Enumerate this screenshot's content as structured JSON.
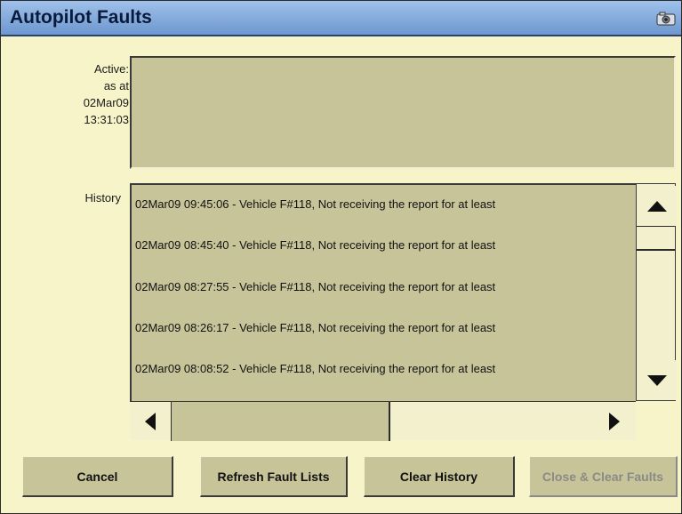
{
  "window": {
    "title": "Autopilot Faults",
    "title_icon": "camera-icon"
  },
  "active": {
    "label_lines": [
      "Active:",
      "as at",
      "02Mar09",
      "13:31:03"
    ],
    "entries": []
  },
  "history": {
    "label": "History",
    "rows": [
      "02Mar09 09:45:06 - Vehicle  F#118, Not receiving the report for at least",
      "02Mar09 08:45:40 - Vehicle  F#118, Not receiving the report for at least",
      "02Mar09 08:27:55 - Vehicle  F#118, Not receiving the report for at least",
      "02Mar09 08:26:17 - Vehicle  F#118, Not receiving the report for at least",
      "02Mar09 08:08:52 - Vehicle  F#118, Not receiving the report for at least"
    ]
  },
  "buttons": {
    "cancel": "Cancel",
    "refresh": "Refresh Fault Lists",
    "clear_history": "Clear History",
    "close_clear": "Close & Clear Faults"
  },
  "colors": {
    "title_bar": "#7ea6dc",
    "panel": "#f7f4c9",
    "field": "#c8c49a",
    "disabled_text": "#8a8a86"
  }
}
